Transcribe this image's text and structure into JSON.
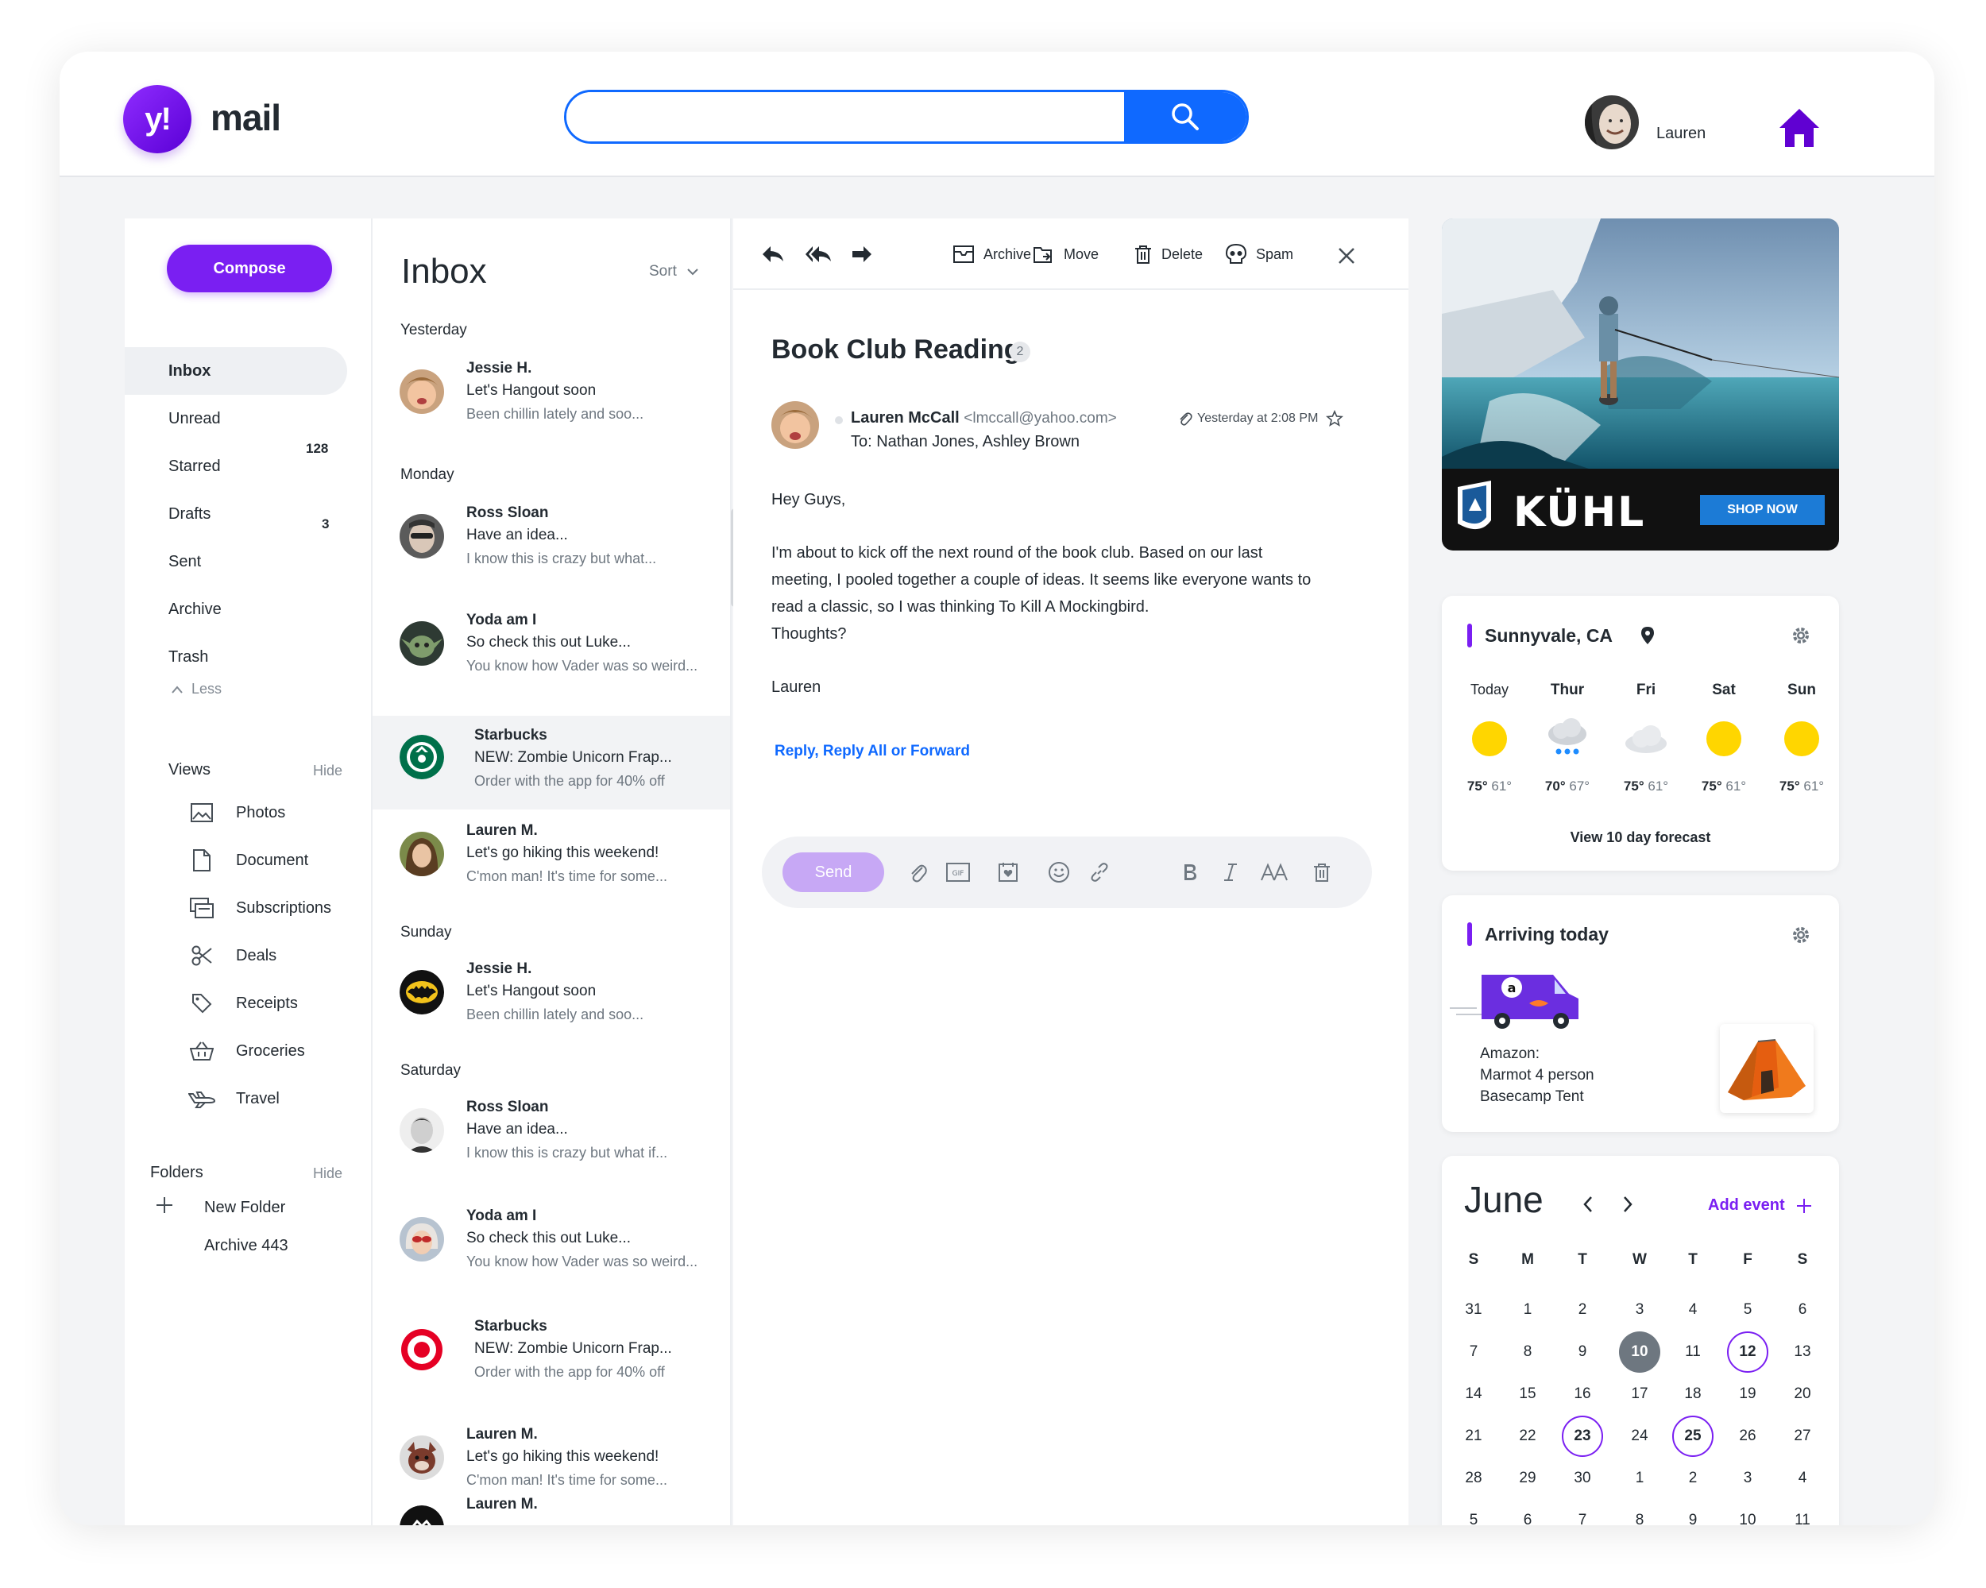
{
  "app": {
    "logo_mark": "y!",
    "logo_text": "mail"
  },
  "search": {
    "placeholder": ""
  },
  "user": {
    "name": "Lauren"
  },
  "colors": {
    "brand": "#7a1ff2",
    "link": "#0f69ff",
    "sun": "#ffd600"
  },
  "sidebar": {
    "compose_label": "Compose",
    "nav": [
      {
        "label": "Inbox",
        "count": ""
      },
      {
        "label": "Unread",
        "count": "128"
      },
      {
        "label": "Starred",
        "count": ""
      },
      {
        "label": "Drafts",
        "count": "3"
      },
      {
        "label": "Sent",
        "count": ""
      },
      {
        "label": "Archive",
        "count": ""
      },
      {
        "label": "Trash",
        "count": ""
      }
    ],
    "less_label": "Less",
    "views_title": "Views",
    "views_hide": "Hide",
    "views": [
      {
        "label": "Photos",
        "icon": "photo-icon"
      },
      {
        "label": "Document",
        "icon": "document-icon"
      },
      {
        "label": "Subscriptions",
        "icon": "subscriptions-icon"
      },
      {
        "label": "Deals",
        "icon": "scissors-icon"
      },
      {
        "label": "Receipts",
        "icon": "tag-icon"
      },
      {
        "label": "Groceries",
        "icon": "basket-icon"
      },
      {
        "label": "Travel",
        "icon": "plane-icon"
      }
    ],
    "folders_title": "Folders",
    "folders_hide": "Hide",
    "new_folder": "New Folder",
    "archive_folder": "Archive 443"
  },
  "inbox": {
    "title": "Inbox",
    "sort_label": "Sort",
    "groups": [
      {
        "day": "Yesterday"
      },
      {
        "day": "Monday"
      },
      {
        "day": "Sunday"
      },
      {
        "day": "Saturday"
      }
    ],
    "messages": [
      {
        "from": "Jessie H.",
        "subject": "Let's Hangout soon",
        "preview": "Been chillin lately and soo..."
      },
      {
        "from": "Ross Sloan",
        "subject": "Have an idea...",
        "preview": "I know this is crazy but what..."
      },
      {
        "from": "Yoda am I",
        "subject": "So check this out Luke...",
        "preview": "You know how Vader was so weird..."
      },
      {
        "from": "Starbucks",
        "subject": "NEW: Zombie Unicorn Frap...",
        "preview": "Order with the app for 40% off"
      },
      {
        "from": "Lauren M.",
        "subject": "Let's go hiking this weekend!",
        "preview": "C'mon man! It's time for some..."
      },
      {
        "from": "Jessie H.",
        "subject": "Let's Hangout soon",
        "preview": "Been chillin lately and soo..."
      },
      {
        "from": "Ross Sloan",
        "subject": "Have an idea...",
        "preview": "I know this is crazy but what if..."
      },
      {
        "from": "Yoda am I",
        "subject": "So check this out Luke...",
        "preview": "You know how Vader was so weird..."
      },
      {
        "from": "Starbucks",
        "subject": "NEW: Zombie Unicorn Frap...",
        "preview": "Order with the app for 40% off"
      },
      {
        "from": "Lauren M.",
        "subject": "Let's go hiking this weekend!",
        "preview": "C'mon man! It's time for some..."
      },
      {
        "from": "Lauren M.",
        "subject": "",
        "preview": ""
      }
    ]
  },
  "reader": {
    "toolbar": {
      "archive": "Archive",
      "move": "Move",
      "delete": "Delete",
      "spam": "Spam"
    },
    "subject": "Book Club Reading",
    "thread_count": "2",
    "sender_name": "Lauren McCall",
    "sender_email": "<lmccall@yahoo.com>",
    "to": "To: Nathan Jones, Ashley Brown",
    "time": "Yesterday at 2:08 PM",
    "greeting": "Hey Guys,",
    "body_lines": [
      "I'm about to kick off the next round of the book club. Based on our last",
      "meeting, I pooled together a couple of ideas. It seems like everyone wants to",
      "read a classic, so I was thinking To Kill A Mockingbird.",
      "Thoughts?"
    ],
    "signature": "Lauren",
    "reply_link": "Reply, Reply All or Forward",
    "send_label": "Send"
  },
  "ad": {
    "brand": "KÜHL",
    "cta": "SHOP NOW"
  },
  "weather": {
    "location": "Sunnyvale, CA",
    "days": [
      {
        "name": "Today",
        "high": "75°",
        "low": "61°",
        "icon": "sun-icon"
      },
      {
        "name": "Thur",
        "high": "70°",
        "low": "67°",
        "icon": "rain-cloud-icon"
      },
      {
        "name": "Fri",
        "high": "75°",
        "low": "61°",
        "icon": "cloud-icon"
      },
      {
        "name": "Sat",
        "high": "75°",
        "low": "61°",
        "icon": "sun-icon"
      },
      {
        "name": "Sun",
        "high": "75°",
        "low": "61°",
        "icon": "sun-icon"
      }
    ],
    "forecast_link": "View 10 day forecast"
  },
  "package": {
    "title": "Arriving today",
    "line1": "Amazon:",
    "line2": "Marmot 4 person",
    "line3": "Basecamp Tent"
  },
  "calendar": {
    "month": "June",
    "add_event": "Add event",
    "weekdays": [
      "S",
      "M",
      "T",
      "W",
      "T",
      "F",
      "S"
    ],
    "weeks": [
      [
        "31",
        "1",
        "2",
        "3",
        "4",
        "5",
        "6"
      ],
      [
        "7",
        "8",
        "9",
        "10",
        "11",
        "12",
        "13"
      ],
      [
        "14",
        "15",
        "16",
        "17",
        "18",
        "19",
        "20"
      ],
      [
        "21",
        "22",
        "23",
        "24",
        "25",
        "26",
        "27"
      ],
      [
        "28",
        "29",
        "30",
        "1",
        "2",
        "3",
        "4"
      ],
      [
        "5",
        "6",
        "7",
        "8",
        "9",
        "10",
        "11"
      ]
    ],
    "today": "10",
    "events": [
      "12",
      "23",
      "25"
    ]
  }
}
